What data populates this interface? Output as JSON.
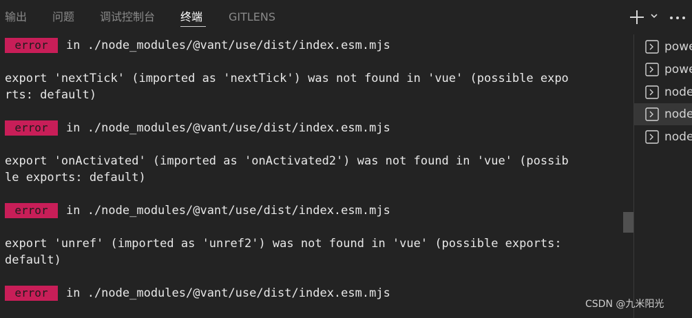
{
  "tabs": [
    {
      "label": "输出",
      "active": false
    },
    {
      "label": "问题",
      "active": false
    },
    {
      "label": "调试控制台",
      "active": false
    },
    {
      "label": "终端",
      "active": true
    },
    {
      "label": "GITLENS",
      "active": false
    }
  ],
  "toolbar": {
    "new_terminal_icon": "plus-icon",
    "dropdown_icon": "chevron-down-icon",
    "more_icon": "ellipsis-icon"
  },
  "terminal": {
    "badge_color": "#c81e58",
    "error_badge": "error",
    "lines": [
      {
        "badge": true,
        "text": "in ./node_modules/@vant/use/dist/index.esm.mjs"
      },
      {
        "badge": false,
        "text": "export 'nextTick' (imported as 'nextTick') was not found in 'vue' (possible expo"
      },
      {
        "badge": false,
        "text": "rts: default)"
      },
      {
        "badge": true,
        "text": "in ./node_modules/@vant/use/dist/index.esm.mjs"
      },
      {
        "badge": false,
        "text": "export 'onActivated' (imported as 'onActivated2') was not found in 'vue' (possib"
      },
      {
        "badge": false,
        "text": "le exports: default)"
      },
      {
        "badge": true,
        "text": "in ./node_modules/@vant/use/dist/index.esm.mjs"
      },
      {
        "badge": false,
        "text": "export 'unref' (imported as 'unref2') was not found in 'vue' (possible exports:"
      },
      {
        "badge": false,
        "text": "default)"
      },
      {
        "badge": true,
        "text": "in ./node_modules/@vant/use/dist/index.esm.mjs"
      }
    ]
  },
  "terminal_list": {
    "icon": "terminal-icon",
    "items": [
      {
        "label": "powe",
        "selected": false
      },
      {
        "label": "powe",
        "selected": false
      },
      {
        "label": "node",
        "selected": false
      },
      {
        "label": "node",
        "selected": true
      },
      {
        "label": "node",
        "selected": false
      }
    ]
  },
  "watermark": "CSDN @九米阳光"
}
